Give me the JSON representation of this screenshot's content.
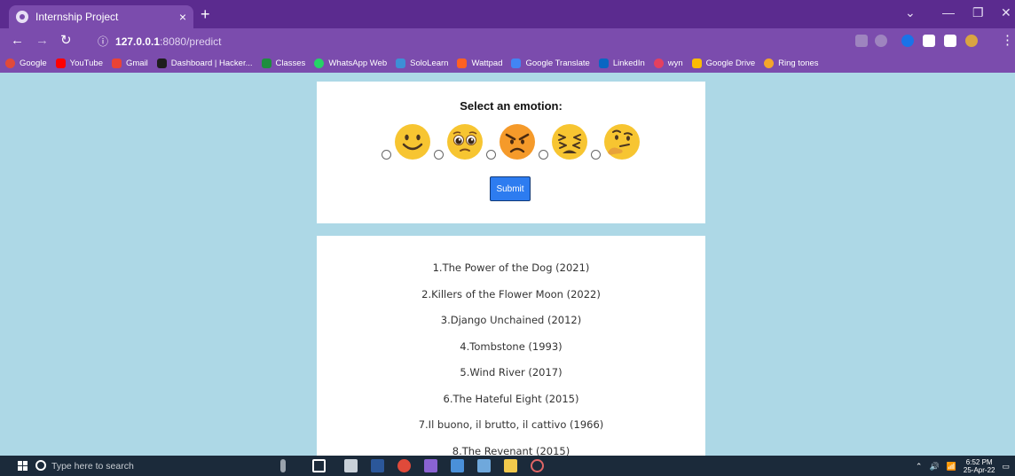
{
  "browser": {
    "tab_title": "Internship Project",
    "tab_close": "×",
    "new_tab": "+",
    "url_host": "127.0.0.1",
    "url_path": ":8080/predict",
    "window_controls": [
      "⌄",
      "—",
      "❐",
      "✕"
    ]
  },
  "bookmarks": [
    {
      "label": "Google",
      "color": "#e04a3a"
    },
    {
      "label": "YouTube",
      "color": "#ff0000"
    },
    {
      "label": "Gmail",
      "color": "#ea4335"
    },
    {
      "label": "Dashboard | Hacker...",
      "color": "#1e1e1e"
    },
    {
      "label": "Classes",
      "color": "#1e8e3e"
    },
    {
      "label": "WhatsApp Web",
      "color": "#25d366"
    },
    {
      "label": "SoloLearn",
      "color": "#3d8fd6"
    },
    {
      "label": "Wattpad",
      "color": "#ff6122"
    },
    {
      "label": "Google Translate",
      "color": "#4285f4"
    },
    {
      "label": "LinkedIn",
      "color": "#0a66c2"
    },
    {
      "label": "wyn",
      "color": "#e4405f"
    },
    {
      "label": "Google Drive",
      "color": "#fbbc04"
    },
    {
      "label": "Ring tones",
      "color": "#f4a62a"
    }
  ],
  "form": {
    "heading": "Select an emotion:",
    "emotions": [
      "happy",
      "pleading",
      "angry",
      "tired",
      "thinking"
    ],
    "submit_label": "Submit"
  },
  "movies": [
    "1.The Power of the Dog (2021)",
    "2.Killers of the Flower Moon (2022)",
    "3.Django Unchained (2012)",
    "4.Tombstone (1993)",
    "5.Wind River (2017)",
    "6.The Hateful Eight (2015)",
    "7.Il buono, il brutto, il cattivo (1966)",
    "8.The Revenant (2015)"
  ],
  "taskbar": {
    "search_placeholder": "Type here to search",
    "time": "6:52 PM",
    "date": "25-Apr-22"
  },
  "colors": {
    "page_background": "#add8e6",
    "browser_purple": "#7b4cad",
    "submit_blue": "#2d7cf0"
  }
}
